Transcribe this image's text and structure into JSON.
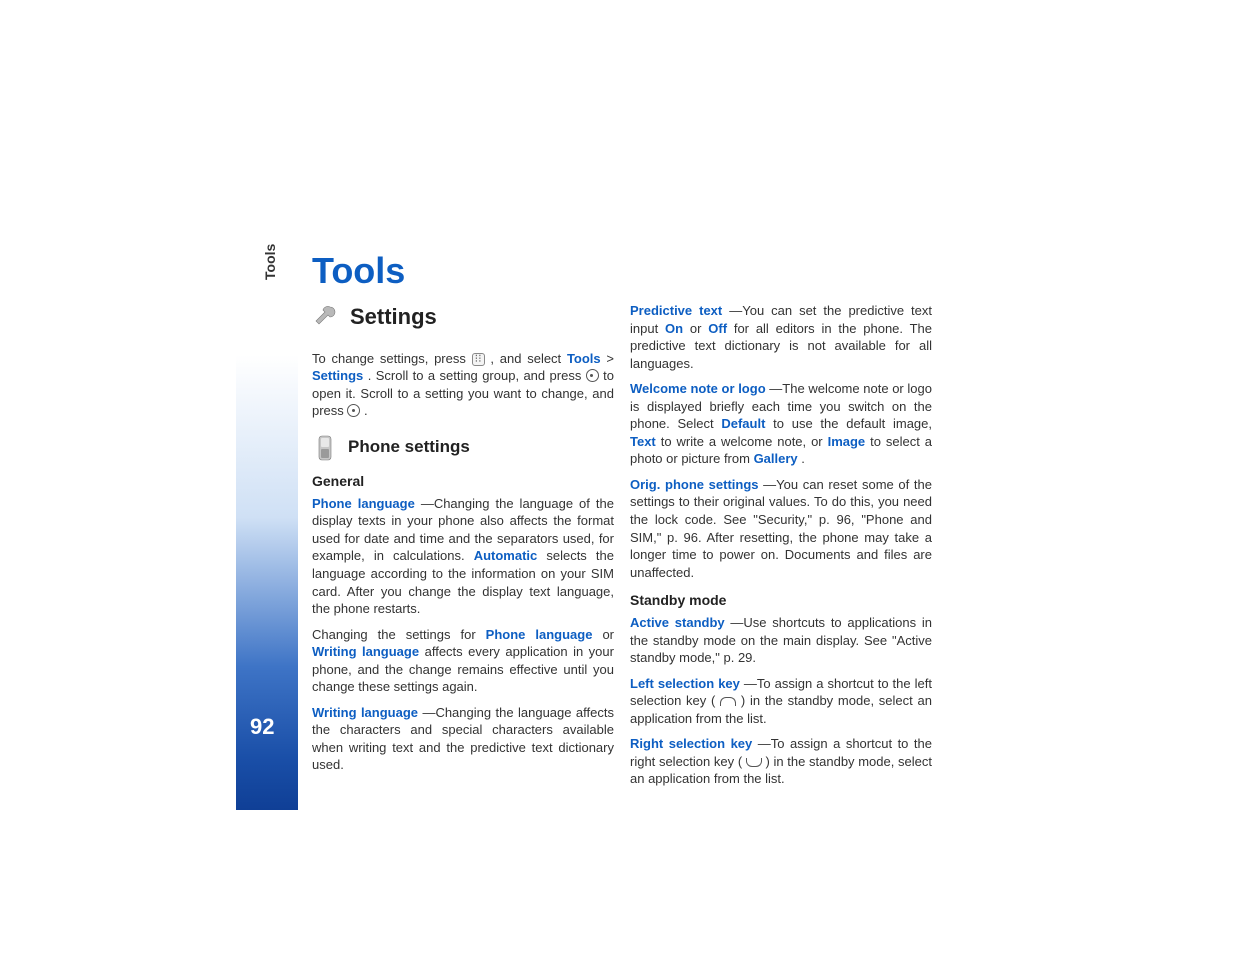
{
  "side_label": "Tools",
  "page_number": "92",
  "title": "Tools",
  "col1": {
    "h2_settings": "Settings",
    "p_change_1a": "To change settings, press ",
    "p_change_1b": ", and select ",
    "link_tools": "Tools",
    "gt": " > ",
    "link_settings": "Settings",
    "p_change_1c": ". Scroll to a setting group, and press ",
    "p_change_1d": " to open it. Scroll to a setting you want to change, and press ",
    "p_change_1e": ".",
    "h3_phone": "Phone settings",
    "h4_general": "General",
    "pl_label": "Phone language",
    "pl_text_a": "—Changing the language of the display texts in your phone also affects the format used for date and time and the separators used, for example, in calculations. ",
    "pl_auto": "Automatic",
    "pl_text_b": " selects the language according to the information on your SIM card. After you change the display text language, the phone restarts.",
    "cs_text_a": "Changing the settings for ",
    "cs_pl": "Phone language",
    "cs_or": " or ",
    "cs_wl": "Writing language",
    "cs_text_b": " affects every application in your phone, and the change remains effective until you change these settings again.",
    "wl_label": "Writing language",
    "wl_text": "—Changing the language affects the characters and special characters available when writing text and the predictive text dictionary used."
  },
  "col2": {
    "pt_label": "Predictive text",
    "pt_a": "—You can set the predictive text input ",
    "pt_on": "On",
    "pt_or": " or ",
    "pt_off": "Off",
    "pt_b": " for all editors in the phone. The predictive text dictionary is not available for all languages.",
    "wn_label": "Welcome note or logo",
    "wn_a": "—The welcome note or logo is displayed briefly each time you switch on the phone. Select ",
    "wn_default": "Default",
    "wn_b": " to use the default image, ",
    "wn_text": "Text",
    "wn_c": " to write a welcome note, or ",
    "wn_image": "Image",
    "wn_d": " to select a photo or picture from ",
    "wn_gallery": "Gallery",
    "wn_e": ".",
    "op_label": "Orig. phone settings",
    "op_text": "—You can reset some of the settings to their original values. To do this, you need the lock code. See \"Security,\" p. 96, \"Phone and SIM,\" p. 96. After resetting, the phone may take a longer time to power on. Documents and files are unaffected.",
    "h4_standby": "Standby mode",
    "as_label": "Active standby",
    "as_text": "—Use shortcuts to applications in the standby mode on the main display. See \"Active standby mode,\" p. 29.",
    "ls_label": "Left selection key",
    "ls_a": "—To assign a shortcut to the left selection key (",
    "ls_b": ") in the standby mode, select an application from the list.",
    "rs_label": "Right selection key",
    "rs_a": "—To assign a shortcut to the right selection key (",
    "rs_b": ") in the standby mode, select an application from the list."
  }
}
